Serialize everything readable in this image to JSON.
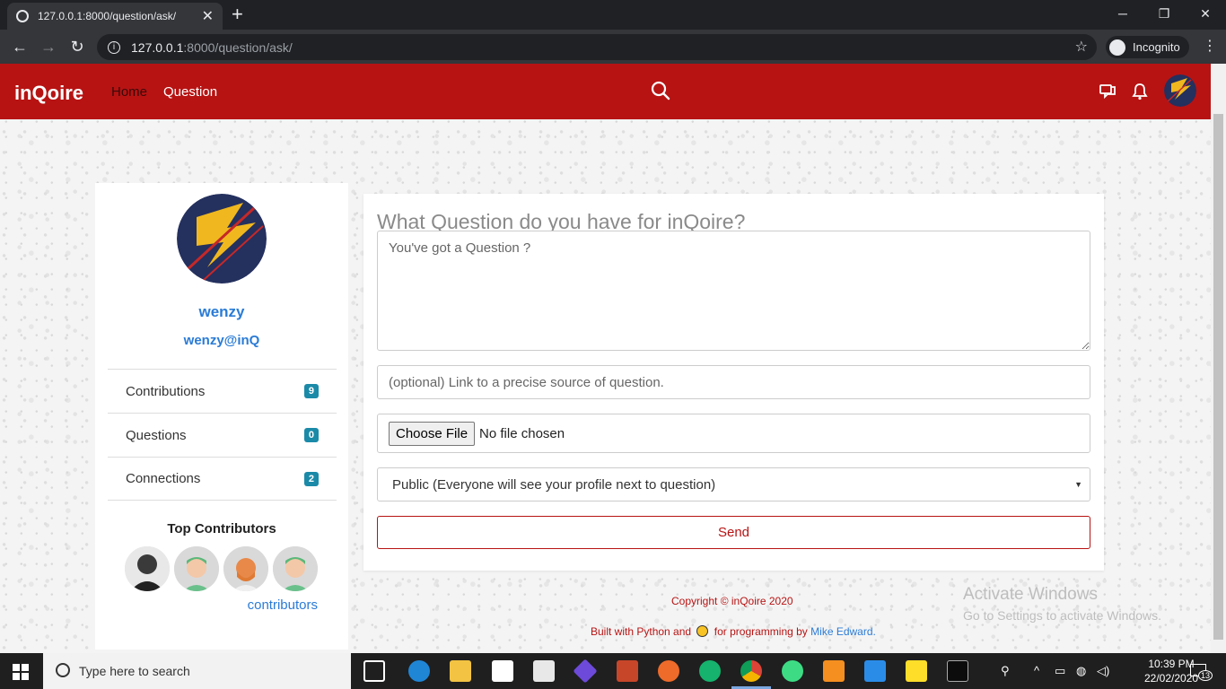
{
  "browser": {
    "tab_title": "127.0.0.1:8000/question/ask/",
    "url_host": "127.0.0.1",
    "url_path": ":8000/question/ask/",
    "incognito_label": "Incognito"
  },
  "navbar": {
    "brand": "inQoire",
    "links": [
      "Home",
      "Question"
    ],
    "accent_color": "#b71313"
  },
  "profile": {
    "username": "wenzy",
    "handle": "wenzy@inQ",
    "stats": [
      {
        "label": "Contributions",
        "count": "9"
      },
      {
        "label": "Questions",
        "count": "0"
      },
      {
        "label": "Connections",
        "count": "2"
      }
    ],
    "top_contributors_title": "Top Contributors",
    "contributors_link": "contributors"
  },
  "form": {
    "title": "What Question do you have for inQoire?",
    "question_placeholder": "You've got a Question ?",
    "source_placeholder": "(optional) Link to a precise source of question.",
    "file_button": "Choose File",
    "file_status": "No file chosen",
    "visibility_selected": "Public (Everyone will see your profile next to question)",
    "send_label": "Send"
  },
  "footer": {
    "copyright": "Copyright © inQoire 2020",
    "built_prefix": "Built with Python and",
    "built_suffix": "for programming by",
    "author": "Mike Edward."
  },
  "watermark": {
    "line1": "Activate Windows",
    "line2": "Go to Settings to activate Windows."
  },
  "taskbar": {
    "search_placeholder": "Type here to search",
    "time": "10:39 PM",
    "date": "22/02/2020",
    "notification_count": "13"
  }
}
